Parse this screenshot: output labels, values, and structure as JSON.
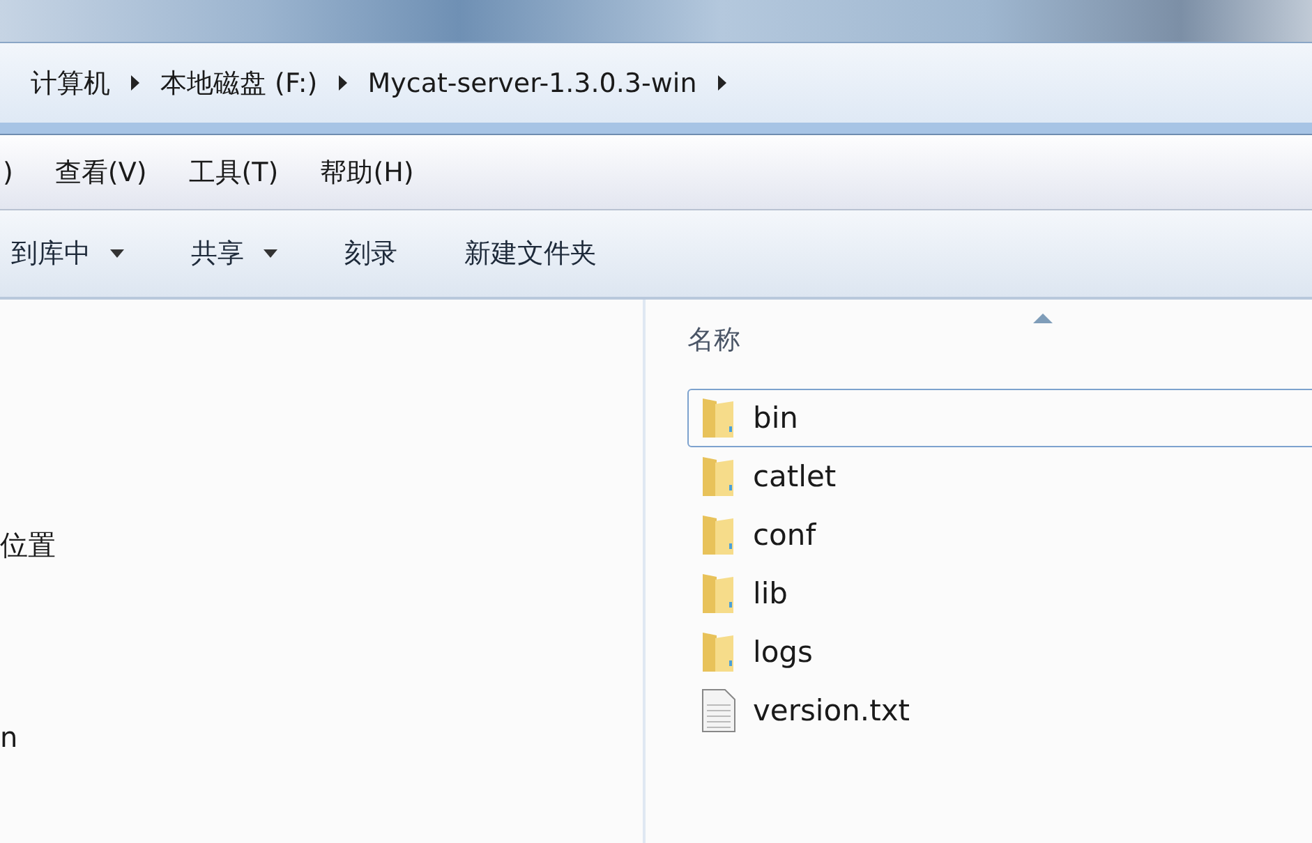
{
  "breadcrumb": [
    {
      "label": "计算机"
    },
    {
      "label": "本地磁盘 (F:)"
    },
    {
      "label": "Mycat-server-1.3.0.3-win"
    }
  ],
  "menu": [
    ")",
    "查看(V)",
    "工具(T)",
    "帮助(H)"
  ],
  "toolbar": [
    {
      "label": "到库中",
      "dropdown": true
    },
    {
      "label": "共享",
      "dropdown": true
    },
    {
      "label": "刻录",
      "dropdown": false
    },
    {
      "label": "新建文件夹",
      "dropdown": false
    }
  ],
  "nav_pane": {
    "items": [
      "位置",
      "n"
    ]
  },
  "file_list": {
    "column": "名称",
    "files": [
      {
        "name": "bin",
        "kind": "folder",
        "selected": true
      },
      {
        "name": "catlet",
        "kind": "folder",
        "selected": false
      },
      {
        "name": "conf",
        "kind": "folder",
        "selected": false
      },
      {
        "name": "lib",
        "kind": "folder",
        "selected": false
      },
      {
        "name": "logs",
        "kind": "folder",
        "selected": false
      },
      {
        "name": "version.txt",
        "kind": "text",
        "selected": false
      }
    ]
  }
}
